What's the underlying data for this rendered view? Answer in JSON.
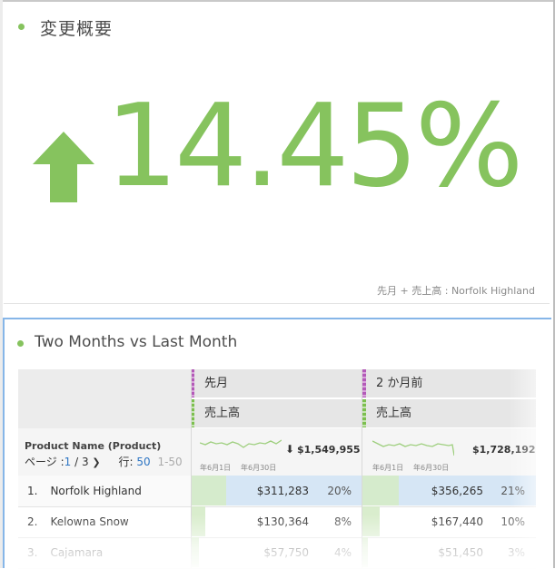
{
  "summary": {
    "title": "変更概要",
    "value": "14.45%",
    "caption": "先月 + 売上高 : Norfolk Highland",
    "direction_icon": "arrow-up-icon",
    "accent_color": "#86c35e"
  },
  "table": {
    "title": "Two Months vs Last Month",
    "dimension": "Product Name (Product)",
    "pager": {
      "page_label": "ページ :",
      "page_current": "1",
      "page_total": "3",
      "rows_label": "行:",
      "rows_value": "50",
      "range": "1-50"
    },
    "columns": [
      {
        "period": "先月",
        "metric": "売上高",
        "total": "$1,549,955",
        "trend_icon": "arrow-down-icon",
        "spark_start": "年6月1日",
        "spark_end": "年6月30日"
      },
      {
        "period": "2 か月前",
        "metric": "売上高",
        "total": "$1,728,192",
        "spark_start": "年6月1日",
        "spark_end": "年6月30日"
      }
    ],
    "rows": [
      {
        "num": "1.",
        "name": "Norfolk Highland",
        "v1": "$311,283",
        "p1": "20%",
        "v2": "$356,265",
        "p2": "21%",
        "share1": 0.2,
        "share2": 0.21
      },
      {
        "num": "2.",
        "name": "Kelowna Snow",
        "v1": "$130,364",
        "p1": "8%",
        "v2": "$167,440",
        "p2": "10%",
        "share1": 0.08,
        "share2": 0.1
      },
      {
        "num": "3.",
        "name": "Cajamara",
        "v1": "$57,750",
        "p1": "4%",
        "v2": "$51,450",
        "p2": "3%",
        "share1": 0.04,
        "share2": 0.03
      }
    ],
    "colors": {
      "header_purple": "#b35ab8",
      "header_green": "#7cbf4f",
      "row_highlight": "#d6e6f5",
      "bar_fill": "#d5ebc8"
    }
  }
}
